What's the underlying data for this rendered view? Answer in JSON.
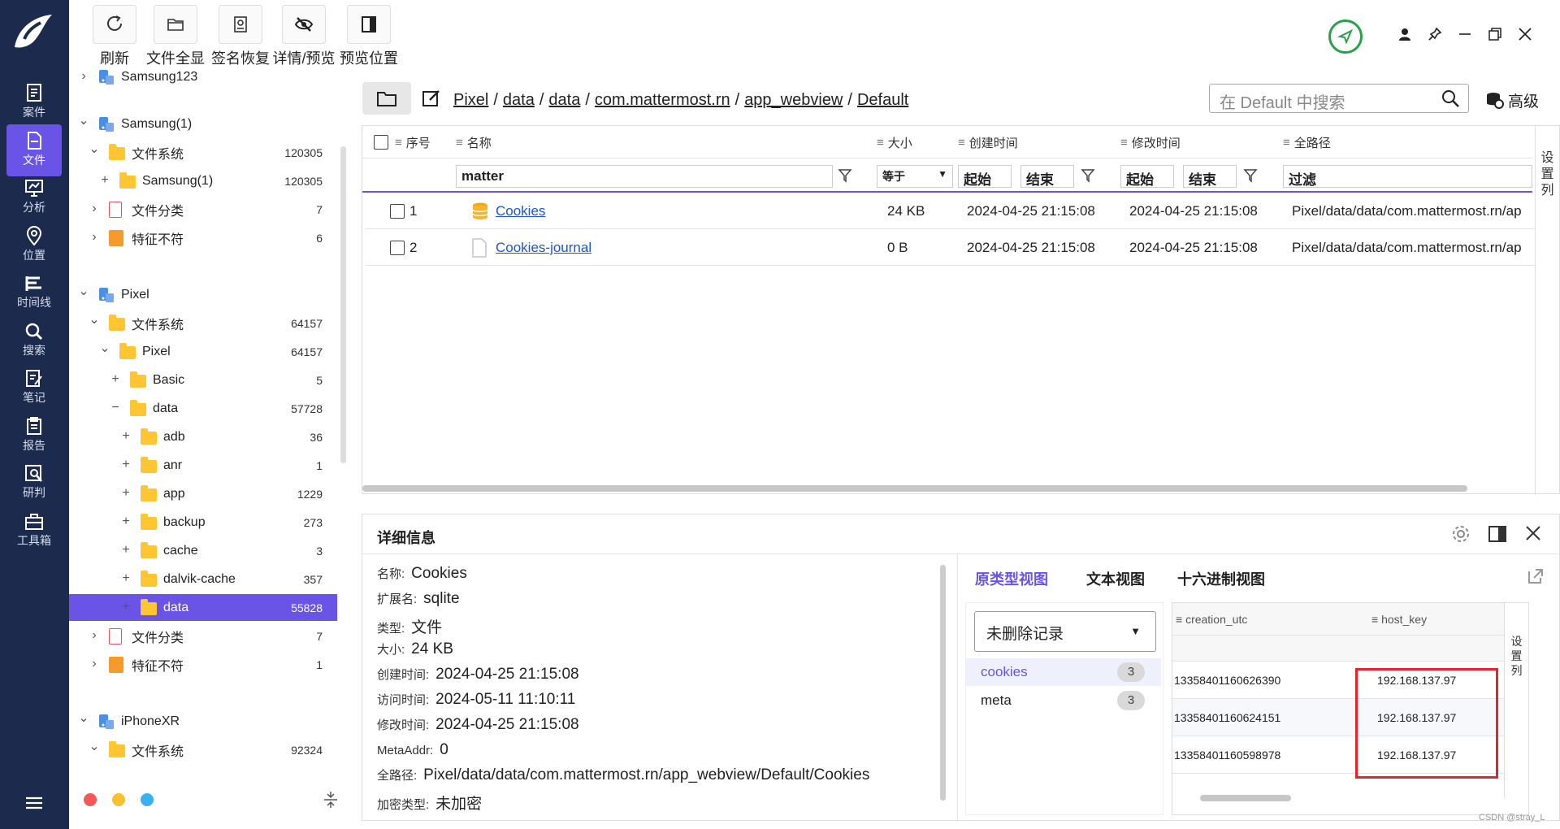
{
  "toolbar": {
    "buttons": [
      {
        "label": "刷新",
        "icon": "refresh-icon"
      },
      {
        "label": "文件全显",
        "icon": "folder-icon"
      },
      {
        "label": "签名恢复",
        "icon": "signature-icon"
      },
      {
        "label": "详情/预览",
        "icon": "eye-off-icon"
      },
      {
        "label": "预览位置",
        "icon": "panel-icon"
      }
    ]
  },
  "nav": {
    "items": [
      {
        "label": "案件",
        "icon": "case-icon"
      },
      {
        "label": "文件",
        "icon": "file-icon",
        "active": true
      },
      {
        "label": "分析",
        "icon": "analysis-icon"
      },
      {
        "label": "位置",
        "icon": "location-icon"
      },
      {
        "label": "时间线",
        "icon": "timeline-icon"
      },
      {
        "label": "搜索",
        "icon": "search-icon"
      },
      {
        "label": "笔记",
        "icon": "note-icon"
      },
      {
        "label": "报告",
        "icon": "report-icon"
      },
      {
        "label": "研判",
        "icon": "judge-icon"
      },
      {
        "label": "工具箱",
        "icon": "toolbox-icon"
      }
    ]
  },
  "tree": {
    "rows": [
      {
        "label": "Samsung123",
        "count": "",
        "kind": "device",
        "toggle": "›"
      },
      {
        "label": "Samsung(1)",
        "count": "",
        "kind": "device",
        "toggle": "⌄"
      },
      {
        "label": "文件系统",
        "count": "120305",
        "kind": "folder",
        "toggle": "⌄"
      },
      {
        "label": "Samsung(1)",
        "count": "120305",
        "kind": "folder",
        "toggle": "+"
      },
      {
        "label": "文件分类",
        "count": "7",
        "kind": "doc",
        "toggle": "›"
      },
      {
        "label": "特征不符",
        "count": "6",
        "kind": "tag",
        "toggle": "›"
      },
      {
        "label": "Pixel",
        "count": "",
        "kind": "device",
        "toggle": "⌄"
      },
      {
        "label": "文件系统",
        "count": "64157",
        "kind": "folder",
        "toggle": "⌄"
      },
      {
        "label": "Pixel",
        "count": "64157",
        "kind": "folder",
        "toggle": "⌄"
      },
      {
        "label": "Basic",
        "count": "5",
        "kind": "folder",
        "toggle": "+"
      },
      {
        "label": "data",
        "count": "57728",
        "kind": "folder",
        "toggle": "−"
      },
      {
        "label": "adb",
        "count": "36",
        "kind": "folder",
        "toggle": "+"
      },
      {
        "label": "anr",
        "count": "1",
        "kind": "folder",
        "toggle": "+"
      },
      {
        "label": "app",
        "count": "1229",
        "kind": "folder",
        "toggle": "+"
      },
      {
        "label": "backup",
        "count": "273",
        "kind": "folder",
        "toggle": "+"
      },
      {
        "label": "cache",
        "count": "3",
        "kind": "folder",
        "toggle": "+"
      },
      {
        "label": "dalvik-cache",
        "count": "357",
        "kind": "folder",
        "toggle": "+"
      },
      {
        "label": "data",
        "count": "55828",
        "kind": "folder",
        "toggle": "+",
        "selected": true
      },
      {
        "label": "文件分类",
        "count": "7",
        "kind": "doc",
        "toggle": "›"
      },
      {
        "label": "特征不符",
        "count": "1",
        "kind": "tag",
        "toggle": "›"
      },
      {
        "label": "iPhoneXR",
        "count": "",
        "kind": "device",
        "toggle": "⌄"
      },
      {
        "label": "文件系统",
        "count": "92324",
        "kind": "folder",
        "toggle": "⌄"
      }
    ]
  },
  "breadcrumb": [
    "Pixel",
    "data",
    "data",
    "com.mattermost.rn",
    "app_webview",
    "Default"
  ],
  "search": {
    "placeholder": "在 Default 中搜索"
  },
  "advanced_label": "高级",
  "settings_col_label": "设置列",
  "file_table": {
    "headers": [
      "序号",
      "名称",
      "大小",
      "创建时间",
      "修改时间",
      "全路径"
    ],
    "filters": {
      "name": "matter",
      "size_op": "等于",
      "start": "起始",
      "end": "结束",
      "start2": "起始",
      "end2": "结束",
      "path": "过滤"
    },
    "rows": [
      {
        "index": "1",
        "name": "Cookies",
        "size": "24 KB",
        "created": "2024-04-25 21:15:08",
        "modified": "2024-04-25 21:15:08",
        "path": "Pixel/data/data/com.mattermost.rn/ap"
      },
      {
        "index": "2",
        "name": "Cookies-journal",
        "size": "0 B",
        "created": "2024-04-25 21:15:08",
        "modified": "2024-04-25 21:15:08",
        "path": "Pixel/data/data/com.mattermost.rn/ap"
      }
    ]
  },
  "details": {
    "title": "详细信息",
    "fields": [
      {
        "k": "名称:",
        "v": "Cookies"
      },
      {
        "k": "扩展名:",
        "v": "sqlite"
      },
      {
        "k": "类型:",
        "v": "文件"
      },
      {
        "k": "大小:",
        "v": "24 KB"
      },
      {
        "k": "创建时间:",
        "v": "2024-04-25 21:15:08"
      },
      {
        "k": "访问时间:",
        "v": "2024-05-11 11:10:11"
      },
      {
        "k": "修改时间:",
        "v": "2024-04-25 21:15:08"
      },
      {
        "k": "MetaAddr:",
        "v": "0"
      },
      {
        "k": "全路径:",
        "v": "Pixel/data/data/com.mattermost.rn/app_webview/Default/Cookies"
      },
      {
        "k": "加密类型:",
        "v": "未加密"
      }
    ],
    "view_tabs": [
      "原类型视图",
      "文本视图",
      "十六进制视图"
    ],
    "record_select": "未删除记录",
    "tables": [
      {
        "name": "cookies",
        "count": "3"
      },
      {
        "name": "meta",
        "count": "3"
      }
    ],
    "grid_headers": [
      "creation_utc",
      "host_key"
    ],
    "grid_rows": [
      {
        "creation_utc": "13358401160626390",
        "host_key": "192.168.137.97"
      },
      {
        "creation_utc": "13358401160624151",
        "host_key": "192.168.137.97"
      },
      {
        "creation_utc": "13358401160598978",
        "host_key": "192.168.137.97"
      }
    ]
  },
  "watermark": "CSDN @stray_L",
  "colors": {
    "nav_bg": "#1c2b4d",
    "accent": "#6a54e8",
    "link": "#1a57d8",
    "highlight": "#e3262b"
  }
}
